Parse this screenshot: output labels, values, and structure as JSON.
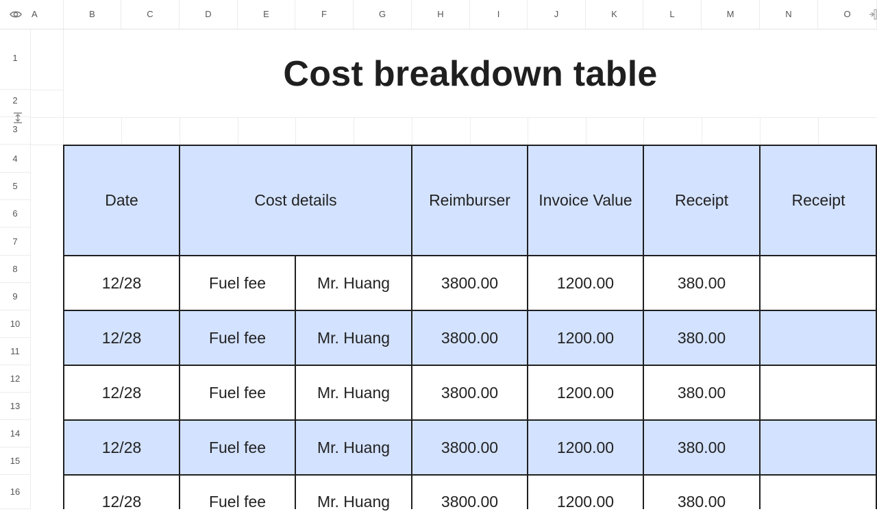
{
  "columns": [
    "A",
    "B",
    "C",
    "D",
    "E",
    "F",
    "G",
    "H",
    "I",
    "J",
    "K",
    "L",
    "M",
    "N",
    "O"
  ],
  "rows": [
    "1",
    "2",
    "3",
    "4",
    "5",
    "6",
    "7",
    "8",
    "9",
    "10",
    "11",
    "12",
    "13",
    "14",
    "15",
    "16"
  ],
  "title": "Cost breakdown table",
  "table": {
    "headers": {
      "date": "Date",
      "cost_details": "Cost details",
      "reimburser": "Reimburser",
      "invoice_value": "Invoice Value",
      "receipt1": "Receipt",
      "receipt2": "Receipt"
    },
    "rows": [
      {
        "date": "12/28",
        "cost": "Fuel fee",
        "person": "Mr. Huang",
        "reimburser": "3800.00",
        "invoice": "1200.00",
        "receipt": "380.00",
        "receipt2": ""
      },
      {
        "date": "12/28",
        "cost": "Fuel fee",
        "person": "Mr. Huang",
        "reimburser": "3800.00",
        "invoice": "1200.00",
        "receipt": "380.00",
        "receipt2": ""
      },
      {
        "date": "12/28",
        "cost": "Fuel fee",
        "person": "Mr. Huang",
        "reimburser": "3800.00",
        "invoice": "1200.00",
        "receipt": "380.00",
        "receipt2": ""
      },
      {
        "date": "12/28",
        "cost": "Fuel fee",
        "person": "Mr. Huang",
        "reimburser": "3800.00",
        "invoice": "1200.00",
        "receipt": "380.00",
        "receipt2": ""
      },
      {
        "date": "12/28",
        "cost": "Fuel fee",
        "person": "Mr. Huang",
        "reimburser": "3800.00",
        "invoice": "1200.00",
        "receipt": "380.00",
        "receipt2": ""
      }
    ]
  },
  "colors": {
    "header_fill": "#d3e2ff",
    "banded_fill": "#d3e2ff",
    "border": "#1f1f1f"
  },
  "icons": {
    "visibility": "eye-icon",
    "row_resize": "row-resize-icon",
    "expand": "expand-panel-icon"
  }
}
